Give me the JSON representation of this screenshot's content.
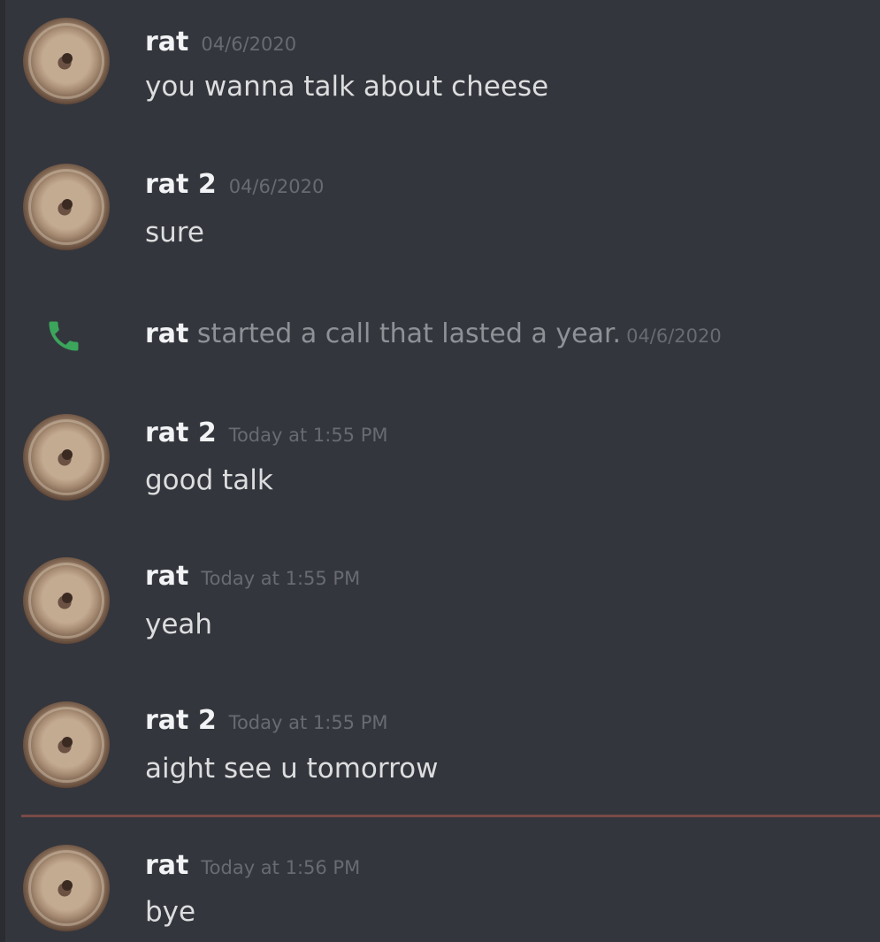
{
  "messages": [
    {
      "author": "rat",
      "timestamp": "04/6/2020",
      "text": "you wanna talk about cheese"
    },
    {
      "author": "rat 2",
      "timestamp": "04/6/2020",
      "text": "sure"
    },
    {
      "author": "rat 2",
      "timestamp": "Today at 1:55 PM",
      "text": "good talk"
    },
    {
      "author": "rat",
      "timestamp": "Today at 1:55 PM",
      "text": "yeah"
    },
    {
      "author": "rat 2",
      "timestamp": "Today at 1:55 PM",
      "text": "aight see u tomorrow"
    },
    {
      "author": "rat",
      "timestamp": "Today at 1:56 PM",
      "text": "bye"
    }
  ],
  "call_notice": {
    "icon": "phone-icon",
    "author": "rat",
    "text": " started a call that lasted a year.",
    "timestamp": "04/6/2020"
  },
  "colors": {
    "background": "#34363d",
    "phone_icon": "#3ba55c",
    "new_messages_divider": "#7a4a46"
  }
}
